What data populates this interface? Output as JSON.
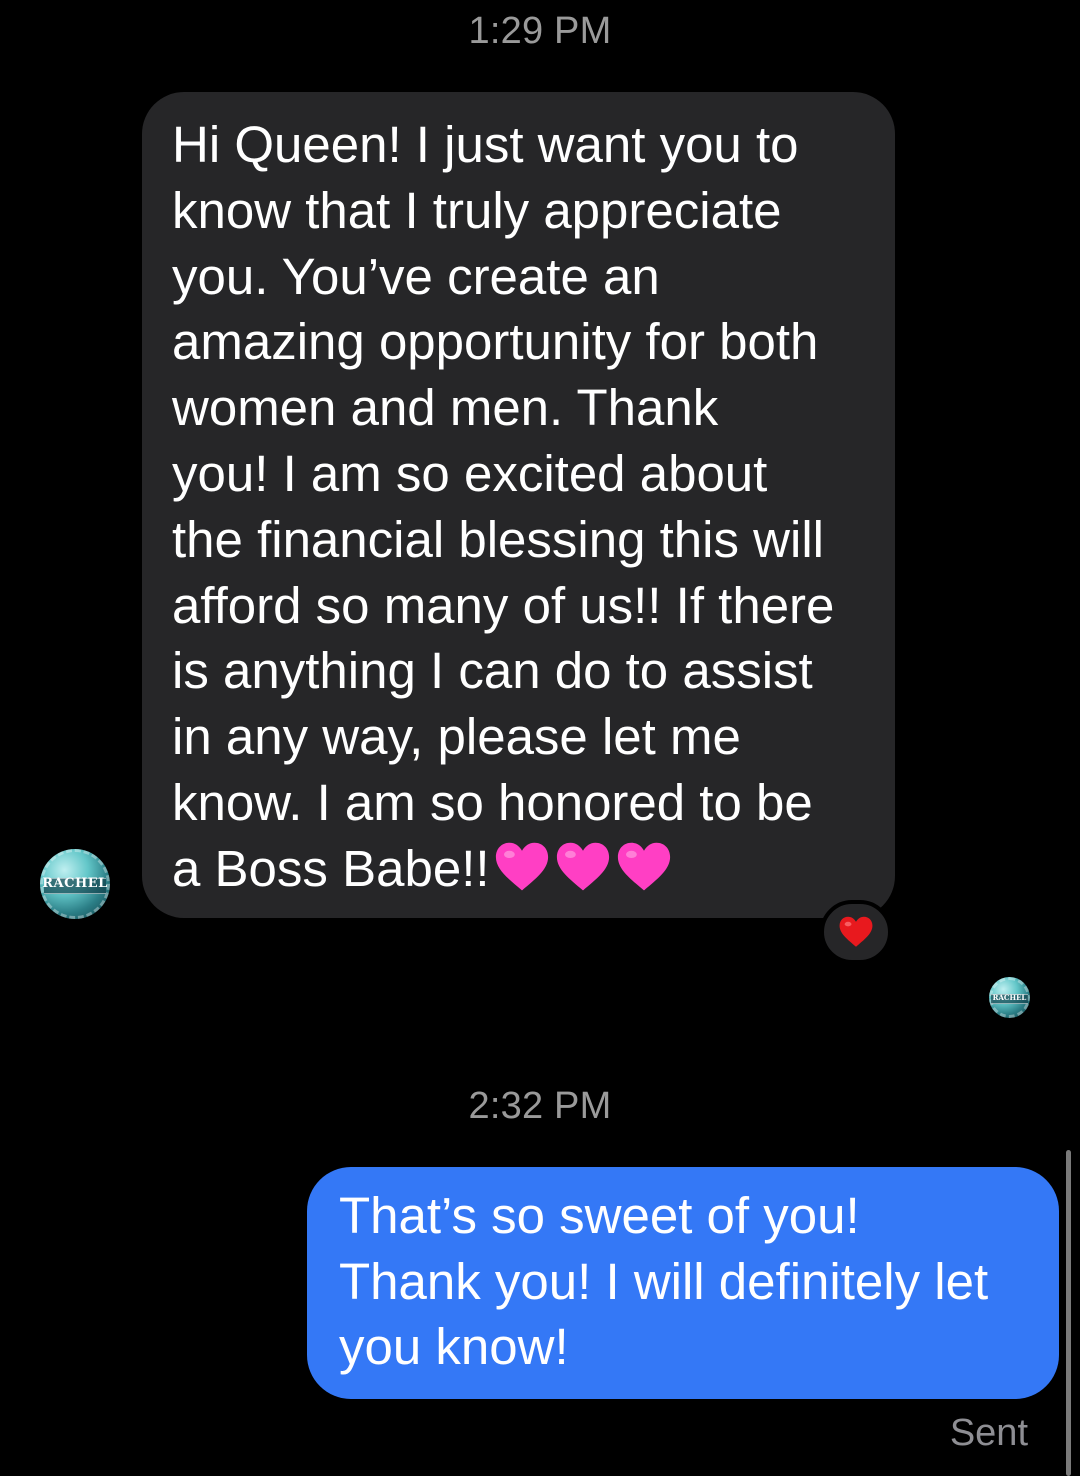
{
  "conversation": {
    "timestamp_1": "1:29 PM",
    "timestamp_2": "2:32 PM",
    "incoming_message": {
      "lines": [
        "Hi Queen!  I just want you to",
        "know that I truly appreciate",
        "you.  You’ve create an",
        "amazing opportunity for both",
        "women and men.  Thank",
        "you!  I am so excited about",
        "the financial blessing this will",
        "afford so many of us!! If there",
        "is anything I can do to assist",
        "in any way, please let me",
        "know.  I am so honored to be",
        "a Boss Babe!!"
      ],
      "trailing_emoji": [
        "pink-heart",
        "pink-heart",
        "pink-heart"
      ],
      "reaction": "red-heart",
      "sender_avatar_text": "RACHEL"
    },
    "outgoing_message": {
      "lines": [
        "That’s so sweet of you!",
        "Thank you! I will definitely let",
        "you know!"
      ],
      "status": "Sent"
    },
    "read_receipt_avatar_text": "RACHEL"
  },
  "colors": {
    "background": "#000000",
    "incoming_bubble": "#262628",
    "outgoing_bubble": "#3478f6",
    "timestamp_text": "#9a9a9a",
    "status_text": "#8e8e93",
    "pink_heart": "#ff3fc4",
    "red_heart": "#e8191e"
  }
}
